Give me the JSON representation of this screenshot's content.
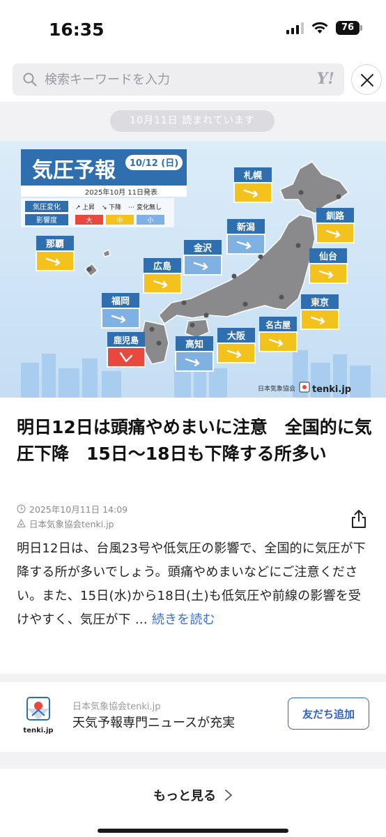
{
  "status_bar": {
    "time": "16:35",
    "battery": "76"
  },
  "search": {
    "placeholder": "検索キーワードを入力",
    "logo": "Y!"
  },
  "reading_badge": "10月11日 読まれています",
  "map": {
    "title": "気圧予報",
    "date_badge": "10/12 (日)",
    "issued": "2025年10月 11日発表",
    "legend_change_label": "気圧変化",
    "legend_rise": "上昇",
    "legend_fall": "下降",
    "legend_none": "変化無し",
    "legend_impact_label": "影響度",
    "legend_high": "大",
    "legend_mid": "中",
    "legend_low": "小",
    "credit": "日本気象協会",
    "brand": "tenki.jp",
    "cities": [
      {
        "name": "札幌",
        "level": "mid"
      },
      {
        "name": "釧路",
        "level": "mid"
      },
      {
        "name": "新潟",
        "level": "low"
      },
      {
        "name": "仙台",
        "level": "mid"
      },
      {
        "name": "那覇",
        "level": "mid"
      },
      {
        "name": "金沢",
        "level": "low"
      },
      {
        "name": "広島",
        "level": "mid"
      },
      {
        "name": "東京",
        "level": "mid"
      },
      {
        "name": "福岡",
        "level": "low"
      },
      {
        "name": "名古屋",
        "level": "mid"
      },
      {
        "name": "大阪",
        "level": "mid"
      },
      {
        "name": "鹿児島",
        "level": "high"
      },
      {
        "name": "高知",
        "level": "low"
      }
    ],
    "colors": {
      "high": "#e8483e",
      "mid": "#f4c21d",
      "low": "#7fb2e3",
      "title_bg": "#2f6fb0"
    }
  },
  "article": {
    "headline": "明日12日は頭痛やめまいに注意　全国的に気圧下降　15日〜18日も下降する所多い",
    "datetime": "2025年10月11日 14:09",
    "source": "日本気象協会tenki.jp",
    "body": "明日12日は、台風23号や低気圧の影響で、全国的に気圧が下降する所が多いでしょう。頭痛やめまいなどにご注意ください。また、15日(水)から18日(土)も低気圧や前線の影響を受けやすく、気圧が下 …",
    "read_more": "続きを読む"
  },
  "publisher": {
    "name": "日本気象協会tenki.jp",
    "description": "天気予報専門ニュースが充実",
    "logo_text": "tenki.jp",
    "follow_label": "友だち追加"
  },
  "more": {
    "label": "もっと見る"
  }
}
